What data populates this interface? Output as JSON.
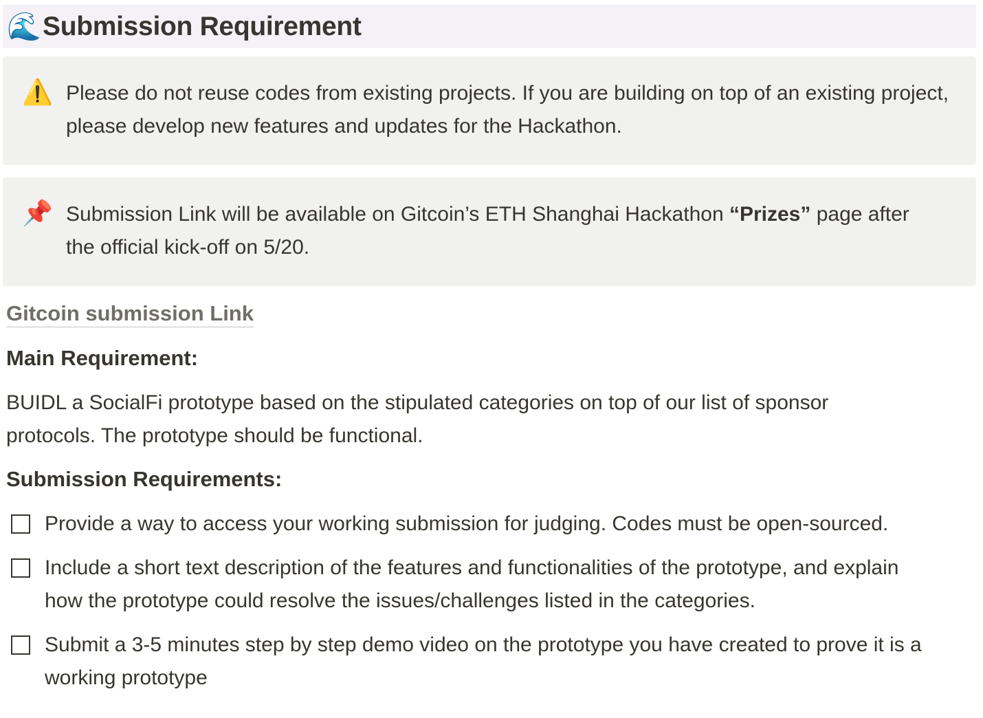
{
  "header": {
    "icon": "water-wave-emoji",
    "emoji": "🌊",
    "title": "Submission Requirement"
  },
  "callouts": [
    {
      "icon": "warning-icon",
      "emoji": "⚠️",
      "text": "Please do not reuse codes from existing projects. If you are building on top of an existing project, please develop new features and updates for the Hackathon."
    },
    {
      "icon": "pushpin-icon",
      "emoji": "📌",
      "text_before": "Submission Link will be available on Gitcoin’s ETH Shanghai Hackathon ",
      "bold": "“Prizes”",
      "text_after": " page after the official kick-off on 5/20."
    }
  ],
  "link": {
    "label": "Gitcoin submission Link"
  },
  "main": {
    "heading": "Main Requirement:",
    "text": "BUIDL a SocialFi prototype based on the stipulated categories on top of our list of sponsor protocols. The prototype should be functional."
  },
  "submission": {
    "heading": "Submission Requirements:",
    "items": [
      {
        "checked": false,
        "text": "Provide a way to access your working submission for judging. Codes must be open-sourced."
      },
      {
        "checked": false,
        "text": "Include a short text description of the features and functionalities of the prototype, and explain how the prototype could resolve the issues/challenges listed in the categories."
      },
      {
        "checked": false,
        "text": "Submit a 3-5 minutes step by step demo video on the prototype you have created to prove it is  a working prototype"
      }
    ]
  }
}
